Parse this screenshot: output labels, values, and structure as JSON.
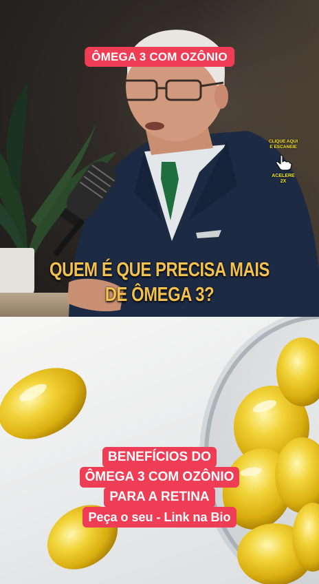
{
  "video": {
    "top_badge": "ÔMEGA 3 COM OZÔNIO",
    "caption_line1": "QUEM É QUE PRECISA MAIS",
    "caption_line2": "DE ÔMEGA 3?",
    "cta": {
      "line1": "CLIQUE AQUI",
      "line2": "E ESCANEIE",
      "speed_line1": "ACELERE",
      "speed_line2": "2X",
      "icon": "pointing-hand-icon"
    }
  },
  "product": {
    "promo_line1": "BENEFÍCIOS DO",
    "promo_line2": "ÔMEGA 3 COM OZÔNIO",
    "promo_line3": "PARA A RETINA",
    "promo_line4": "Peça o seu - Link na Bio"
  },
  "colors": {
    "badge_red": "#ee3d55",
    "caption_yellow": "#f2c14e",
    "capsule_gold": "#e8c21a"
  }
}
